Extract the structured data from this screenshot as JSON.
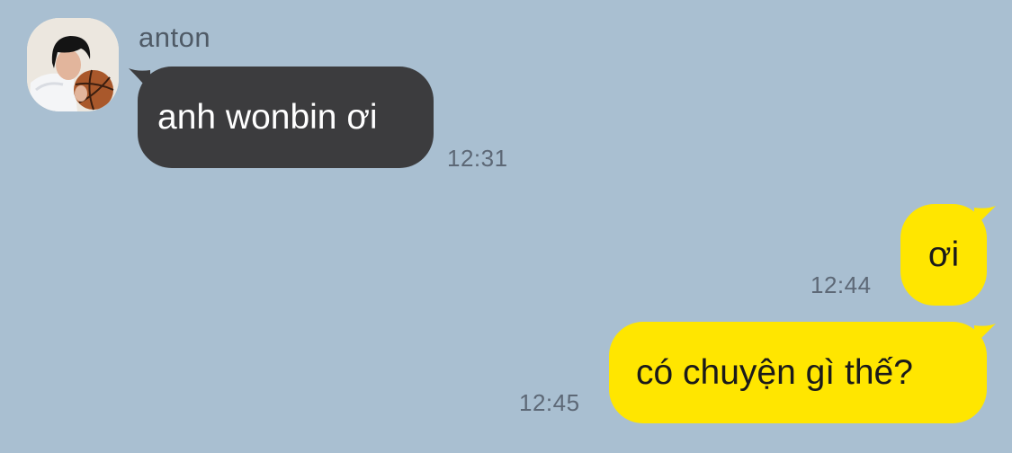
{
  "contact": {
    "name": "anton"
  },
  "messages": [
    {
      "direction": "incoming",
      "text": "anh wonbin ơi",
      "time": "12:31"
    },
    {
      "direction": "outgoing",
      "text": "ơi",
      "time": "12:44"
    },
    {
      "direction": "outgoing",
      "text": "có chuyện gì thế?",
      "time": "12:45"
    }
  ],
  "colors": {
    "background": "#a9bfd1",
    "incoming_bubble": "#3c3c3e",
    "outgoing_bubble": "#ffe600"
  },
  "icons": {
    "avatar": "profile-photo"
  }
}
